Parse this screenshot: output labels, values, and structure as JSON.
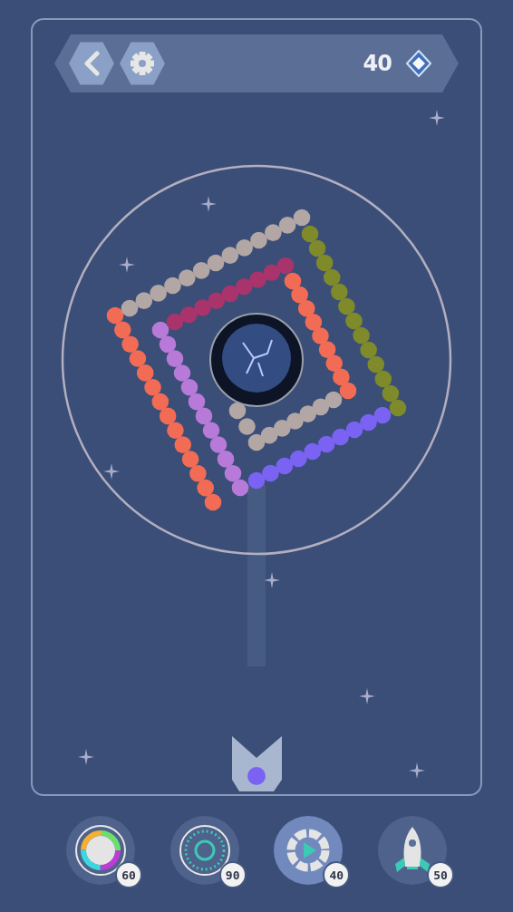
{
  "header": {
    "gems": "40"
  },
  "chain": [
    {
      "color": "#f26c55"
    },
    {
      "color": "#b3a7a5"
    },
    {
      "color": "#7f8a2a"
    },
    {
      "color": "#7a63f2"
    },
    {
      "color": "#b77ad8"
    },
    {
      "color": "#a9336b"
    },
    {
      "color": "#f26c55"
    },
    {
      "color": "#b3a7a5"
    }
  ],
  "powerups": [
    {
      "kind": "color-ring",
      "count": "60",
      "selected": false
    },
    {
      "kind": "target",
      "count": "90",
      "selected": false
    },
    {
      "kind": "play",
      "count": "40",
      "selected": true
    },
    {
      "kind": "rocket",
      "count": "50",
      "selected": false
    }
  ]
}
